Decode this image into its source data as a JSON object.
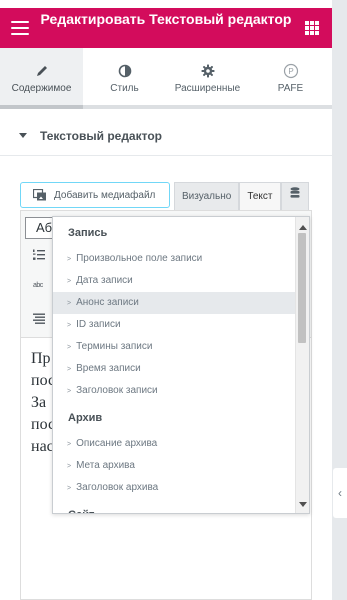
{
  "header": {
    "title": "Редактировать Текстовый редактор"
  },
  "tabs": [
    {
      "label": "Содержимое",
      "icon": "pencil-icon",
      "active": true
    },
    {
      "label": "Стиль",
      "icon": "half-circle-icon",
      "active": false
    },
    {
      "label": "Расширенные",
      "icon": "gear-icon",
      "active": false
    },
    {
      "label": "PAFE",
      "icon": "pafe-logo-icon",
      "active": false
    }
  ],
  "section": {
    "title": "Текстовый редактор"
  },
  "toolbar": {
    "add_media_label": "Добавить медиафайл",
    "visual_tab": "Визуально",
    "text_tab": "Текст"
  },
  "editor": {
    "format_value": "Аб",
    "text_lines": [
      "Пр",
      "пос",
      "За",
      "пос",
      "нас"
    ]
  },
  "dropdown": {
    "groups": [
      {
        "label": "Запись",
        "items": [
          "Произвольное поле записи",
          "Дата записи",
          "Анонс записи",
          "ID записи",
          "Термины записи",
          "Время записи",
          "Заголовок записи"
        ]
      },
      {
        "label": "Архив",
        "items": [
          "Описание архива",
          "Мета архива",
          "Заголовок архива"
        ]
      },
      {
        "label": "Сайт",
        "items": []
      }
    ],
    "highlighted": "Анонс записи"
  },
  "colors": {
    "brand": "#d30c5c",
    "accent_border": "#71d7f7"
  }
}
